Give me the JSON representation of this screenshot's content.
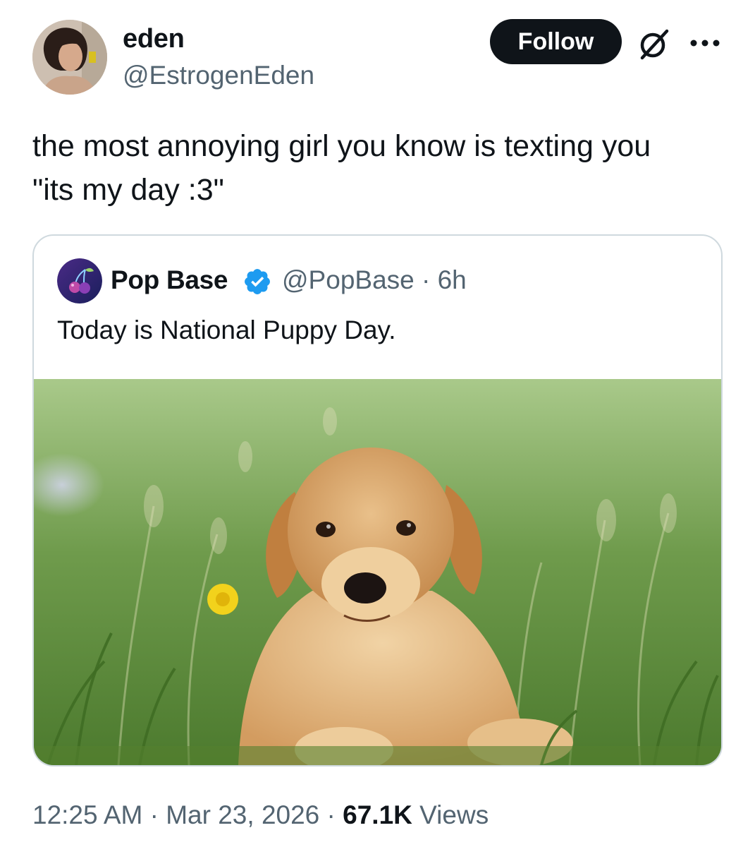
{
  "author": {
    "display_name": "eden",
    "handle": "@EstrogenEden"
  },
  "header": {
    "follow_label": "Follow",
    "icons": [
      "avatar-photo",
      "grok-icon",
      "more-icon"
    ]
  },
  "tweet": {
    "text_line1": "the most annoying girl you know is texting you",
    "text_line2": "\"its my day :3\""
  },
  "quoted": {
    "display_name": "Pop Base",
    "handle_time": "@PopBase · 6h",
    "text": "Today is National Puppy Day.",
    "icons": [
      "cherry-avatar-icon",
      "verified-badge-icon"
    ],
    "media": "golden retriever puppy lying in green grass"
  },
  "meta": {
    "time": "12:25 AM",
    "sep1": " · ",
    "date": "Mar 23, 2026",
    "sep2": " · ",
    "views_count": "67.1K",
    "views_label": " Views"
  },
  "colors": {
    "text": "#0f1419",
    "secondary": "#536471",
    "border": "#cfd9de",
    "verified": "#1d9bf0",
    "follow_bg": "#0f1419"
  }
}
